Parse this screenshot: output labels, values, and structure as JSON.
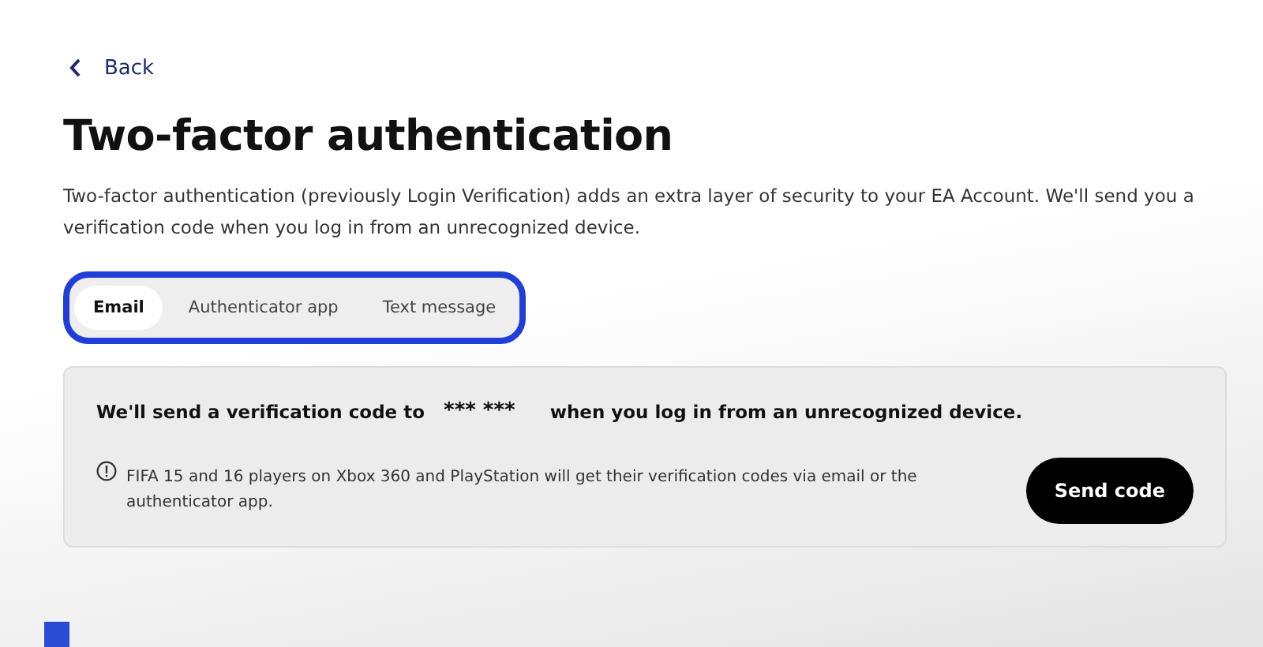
{
  "back_link": {
    "label": "Back"
  },
  "title": "Two-factor authentication",
  "description": "Two-factor authentication (previously Login Verification) adds an extra layer of security to your EA Account. We'll send you a verification code when you log in from an unrecognized device.",
  "tabs": [
    {
      "label": "Email",
      "selected": true
    },
    {
      "label": "Authenticator app",
      "selected": false
    },
    {
      "label": "Text message",
      "selected": false
    }
  ],
  "panel": {
    "message_start": "We'll send a verification code to",
    "masked_address": "*** ***",
    "message_end": "when you log in from an unrecognized device.",
    "note": "FIFA 15 and 16 players on Xbox 360 and PlayStation will get their verification codes via email or the authenticator app.",
    "button": "Send code"
  }
}
